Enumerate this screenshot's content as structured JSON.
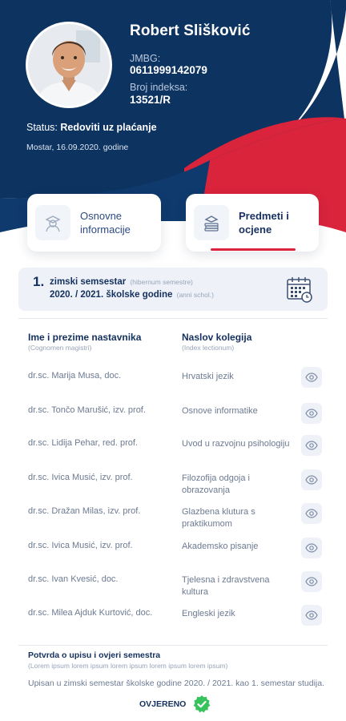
{
  "profile": {
    "name": "Robert Slišković",
    "jmbg_label": "JMBG:",
    "jmbg_value": "0611999142079",
    "index_label": "Broj indeksa:",
    "index_value": "13521/R",
    "status_label": "Status:",
    "status_value": "Redoviti uz plaćanje",
    "place_date": "Mostar, 16.09.2020. godine"
  },
  "tabs": [
    {
      "label": "Osnovne informacije",
      "icon": "student-icon",
      "active": false
    },
    {
      "label": "Predmeti i ocjene",
      "icon": "books-icon",
      "active": true
    }
  ],
  "semester": {
    "number": "1.",
    "title": "zimski semsestar",
    "title_latin": "(hibernum semestre)",
    "year": "2020. / 2021. školske godine",
    "year_latin": "(anni schol.)",
    "icon": "calendar-icon"
  },
  "table": {
    "col1": "Ime i prezime nastavnika",
    "col1_latin": "(Cognomen magistri)",
    "col2": "Naslov kolegija",
    "col2_latin": "(Index lectionum)",
    "rows": [
      {
        "teacher": "dr.sc. Marija Musa, doc.",
        "course": "Hrvatski jezik"
      },
      {
        "teacher": "dr.sc. Tončo Marušić, izv. prof.",
        "course": "Osnove informatike"
      },
      {
        "teacher": "dr.sc. Lidija Pehar, red. prof.",
        "course": "Uvod u razvojnu psihologiju"
      },
      {
        "teacher": "dr.sc. Ivica Musić, izv. prof.",
        "course": "Filozofija odgoja i obrazovanja"
      },
      {
        "teacher": "dr.sc. Dražan Milas, izv. prof.",
        "course": "Glazbena klutura s praktikumom"
      },
      {
        "teacher": "dr.sc. Ivica Musić, izv. prof.",
        "course": "Akademsko pisanje"
      },
      {
        "teacher": "dr.sc. Ivan Kvesić, doc.",
        "course": "Tjelesna i zdravstvena kultura"
      },
      {
        "teacher": "dr.sc. Milea Ajduk Kurtović, doc.",
        "course": "Engleski jezik"
      }
    ]
  },
  "confirmation": {
    "title": "Potvrda o upisu i ovjeri semestra",
    "subtitle": "(Lorem ipsum lorem ipsum lorem ipsum lorem ipsum lorem ipsum)",
    "text": "Upisan u zimski semestar školske godine 2020. / 2021. kao 1. semestar studija.",
    "verified_label": "OVJERENO",
    "verified_icon": "check-badge-icon"
  },
  "colors": {
    "navy": "#0d3361",
    "red": "#d9243b",
    "verified_green": "#37c25c"
  }
}
